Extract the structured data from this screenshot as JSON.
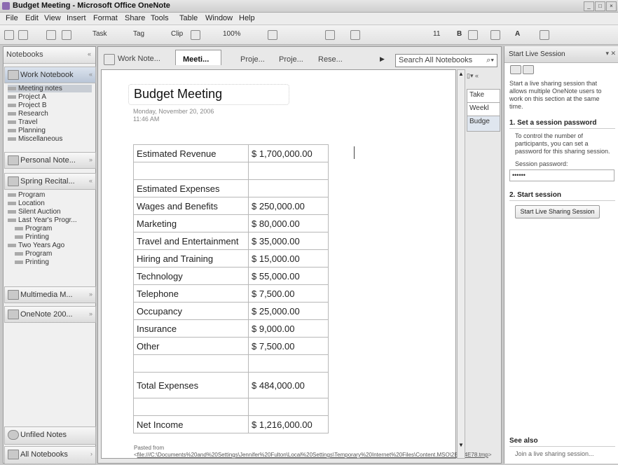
{
  "window": {
    "title": "Budget Meeting - Microsoft Office OneNote"
  },
  "menu": [
    "File",
    "Edit",
    "View",
    "Insert",
    "Format",
    "Share",
    "Tools",
    "Table",
    "Window",
    "Help"
  ],
  "toolbar": {
    "task": "Task",
    "tag": "Tag",
    "clip": "Clip",
    "zoom": "100%",
    "fontsize": "11"
  },
  "nav": {
    "header": "Notebooks",
    "notebooks": [
      {
        "label": "Work Notebook"
      },
      {
        "label": "Personal Note..."
      },
      {
        "label": "Spring Recital..."
      },
      {
        "label": "Multimedia M..."
      },
      {
        "label": "OneNote 200..."
      }
    ],
    "work_sections": [
      "Meeting notes",
      "Project A",
      "Project B",
      "Research",
      "Travel",
      "Planning",
      "Miscellaneous"
    ],
    "spring_sections": [
      "Program",
      "Location",
      "Silent Auction",
      "Last Year's Progr...",
      "Program",
      "Printing",
      "Two Years Ago",
      "Program",
      "Printing"
    ],
    "unfiled": "Unfiled Notes",
    "all": "All Notebooks"
  },
  "tabs": [
    {
      "label": "Work Note..."
    },
    {
      "label": "Meeti..."
    },
    {
      "label": "Proje..."
    },
    {
      "label": "Proje..."
    },
    {
      "label": "Rese..."
    }
  ],
  "search": {
    "placeholder": "Search All Notebooks"
  },
  "page": {
    "title": "Budget Meeting",
    "date": "Monday, November 20, 2006",
    "time": "11:46 AM",
    "rows": [
      {
        "label": "Estimated Revenue",
        "value": "$ 1,700,000.00"
      },
      {
        "label": "",
        "value": ""
      },
      {
        "label": "Estimated Expenses",
        "value": ""
      },
      {
        "label": "Wages and Benefits",
        "value": "$ 250,000.00"
      },
      {
        "label": "Marketing",
        "value": "$ 80,000.00"
      },
      {
        "label": "Travel and Entertainment",
        "value": "$ 35,000.00"
      },
      {
        "label": "Hiring and Training",
        "value": "$ 15,000.00"
      },
      {
        "label": "Technology",
        "value": "$ 55,000.00"
      },
      {
        "label": "Telephone",
        "value": "$ 7,500.00"
      },
      {
        "label": "Occupancy",
        "value": "$ 25,000.00"
      },
      {
        "label": "Insurance",
        "value": "$ 9,000.00"
      },
      {
        "label": "Other",
        "value": "$ 7,500.00"
      },
      {
        "label": "",
        "value": ""
      },
      {
        "label": "Total Expenses",
        "value": "$ 484,000.00"
      },
      {
        "label": "",
        "value": ""
      },
      {
        "label": "Net Income",
        "value": "$ 1,216,000.00"
      }
    ],
    "pasted_prefix": "Pasted from <",
    "pasted_link": "file:///C:\\Documents%20and%20Settings\\Jennifer%20Fulton\\Local%20Settings\\Temporary%20Internet%20Files\\Content.MSO\\2B384E78.tmp",
    "pasted_suffix": ">"
  },
  "page_tabs": [
    "Take",
    "Weekl",
    "Budge"
  ],
  "task_pane": {
    "title": "Start Live Session",
    "intro": "Start a live sharing session that allows multiple OneNote users to work on this section at the same time.",
    "step1": "1. Set a session password",
    "step1_text": "To control the number of participants, you can set a password for this sharing session.",
    "pwd_label": "Session password:",
    "pwd_value": "••••••",
    "step2": "2. Start session",
    "start_button": "Start Live Sharing Session",
    "see_also": "See also",
    "join": "Join a live sharing session..."
  }
}
